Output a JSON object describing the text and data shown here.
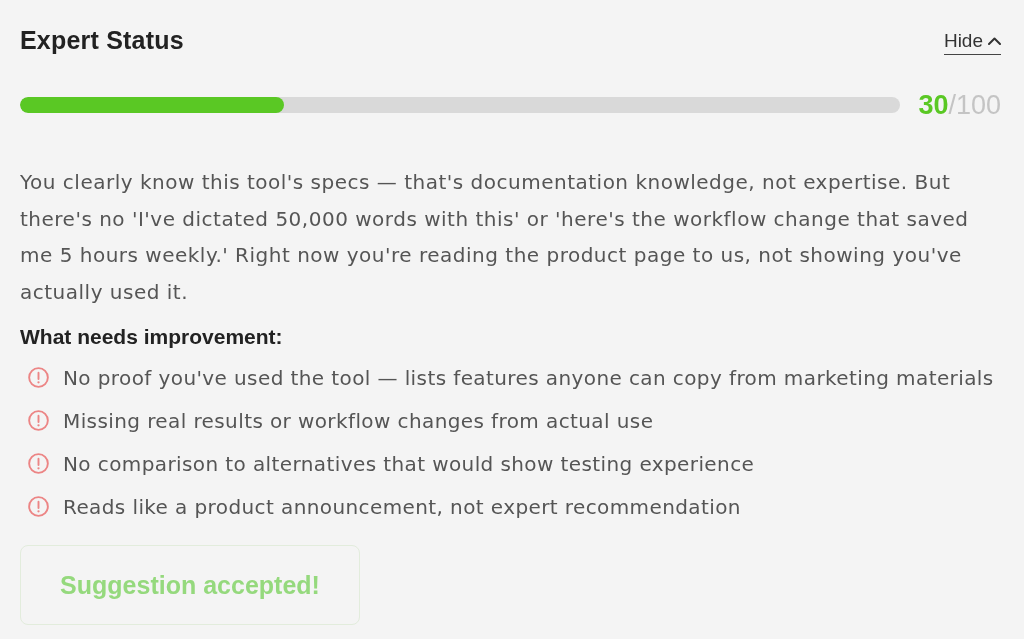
{
  "header": {
    "title": "Expert Status",
    "toggle": {
      "label": "Hide",
      "expanded": true
    }
  },
  "progress": {
    "level": 0.3,
    "score": "30",
    "total": "/100"
  },
  "feedback": "You clearly know this tool's specs — that's documentation knowledge, not expertise. But there's no 'I've dictated 50,000 words with this' or 'here's the workflow change that saved me 5 hours weekly.' Right now you're reading the product page to us, not showing you've actually used it.",
  "improvements": {
    "heading": "What needs improvement:",
    "items": [
      "No proof you've used the tool — lists features anyone can copy from marketing materials",
      "Missing real results or workflow changes from actual use",
      "No comparison to alternatives that would show testing experience",
      "Reads like a product announcement, not expert recommendation"
    ]
  },
  "action": {
    "label": "Suggestion accepted!",
    "disabled": true
  }
}
